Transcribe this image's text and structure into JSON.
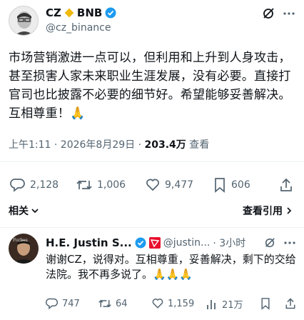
{
  "post": {
    "author_name": "CZ",
    "author_suffix": "BNB",
    "handle": "@cz_binance",
    "text": "市场营销激进一点可以，但利用和上升到人身攻击，甚至损害人家未来职业生涯发展，没有必要。直接打官司也比披露不必要的细节好。希望能够妥善解决。互相尊重！🙏",
    "timestamp": "上午1:11 · 2026年8月29日 · ",
    "views": "203.4万",
    "views_label": " 查看",
    "stats": {
      "replies": "2,128",
      "reposts": "1,006",
      "likes": "9,477",
      "bookmarks": "606"
    },
    "related_label": "相关",
    "quotes_label": "查看引用"
  },
  "reply": {
    "author_name": "H.E. Justin S...",
    "handle": "@justin...",
    "time": "· 3小时",
    "text": "谢谢CZ，说得对。互相尊重，妥善解决，剩下的交给法院。我不再多说了。🙏🙏🙏",
    "stats": {
      "replies": "747",
      "reposts": "64",
      "likes": "1,159",
      "views": "21万"
    }
  },
  "colors": {
    "verified": "#1d9bf0",
    "bnb": "#f0b90b",
    "tron": "#e8112d",
    "muted": "#536471"
  },
  "icons": [
    "grok-icon",
    "more-icon",
    "reply-icon",
    "repost-icon",
    "like-icon",
    "bookmark-icon",
    "share-icon",
    "views-icon",
    "verified-badge-icon"
  ]
}
